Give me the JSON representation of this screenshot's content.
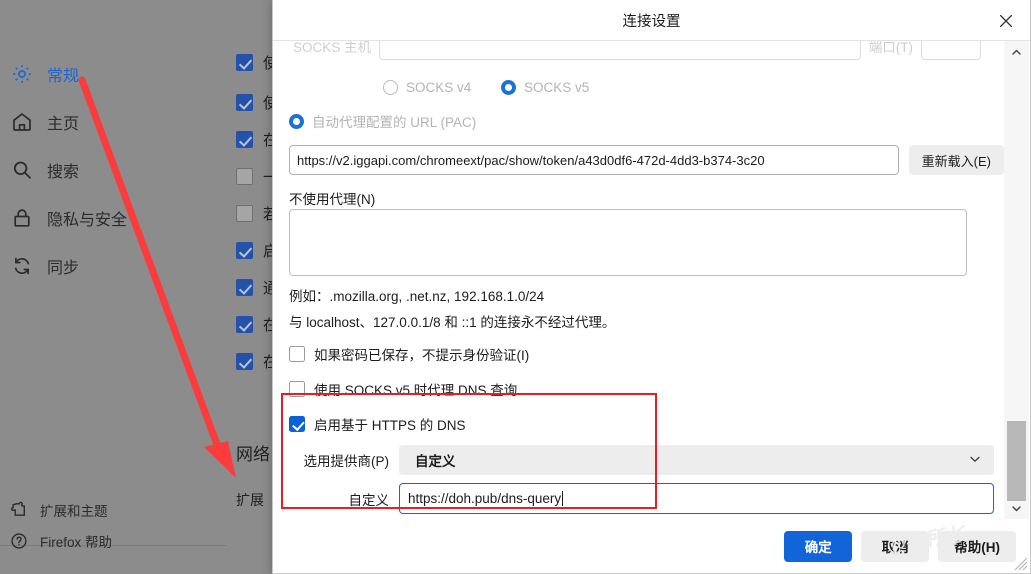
{
  "background": {
    "sidebar": {
      "items": [
        {
          "label": "常规",
          "icon": "gear-icon",
          "active": true
        },
        {
          "label": "主页",
          "icon": "home-icon",
          "active": false
        },
        {
          "label": "搜索",
          "icon": "search-icon",
          "active": false
        },
        {
          "label": "隐私与安全",
          "icon": "lock-icon",
          "active": false
        },
        {
          "label": "同步",
          "icon": "sync-icon",
          "active": false
        }
      ],
      "footer_items": [
        {
          "label": "扩展和主题",
          "icon": "puzzle-icon"
        },
        {
          "label": "Firefox 帮助",
          "icon": "help-circle-icon"
        }
      ]
    },
    "content": {
      "checkbox_rows": [
        {
          "text": "使",
          "checked": true
        },
        {
          "text": "使",
          "checked": true
        },
        {
          "text": "在",
          "checked": true
        },
        {
          "text": "一",
          "checked": false
        },
        {
          "text": "若",
          "checked": false
        },
        {
          "text": "启",
          "checked": true
        },
        {
          "text": "通",
          "checked": true
        },
        {
          "text": "在",
          "checked": true
        },
        {
          "text": "在",
          "checked": true
        }
      ],
      "section_title": "网络",
      "extension_label": "扩展"
    }
  },
  "dialog": {
    "title": "连接设置",
    "close_label": "✕",
    "socks": {
      "host_label": "SOCKS 主机",
      "host_value": "",
      "port_label": "端口(T)",
      "port_value": "",
      "version_options": [
        {
          "label": "SOCKS v4",
          "selected": false
        },
        {
          "label": "SOCKS v5",
          "selected": true
        }
      ]
    },
    "pac": {
      "radio_label": "自动代理配置的 URL (PAC)",
      "radio_selected": true,
      "url_value": "https://v2.iggapi.com/chromeext/pac/show/token/a43d0df6-472d-4dd3-b374-3c20",
      "reload_button": "重新载入(E)"
    },
    "no_proxy": {
      "label": "不使用代理(N)",
      "value": "",
      "example": "例如：.mozilla.org, .net.nz, 192.168.1.0/24",
      "note": "与 localhost、127.0.0.1/8 和 ::1 的连接永不经过代理。"
    },
    "checkboxes": [
      {
        "label": "如果密码已保存，不提示身份验证(I)",
        "checked": false
      },
      {
        "label": "使用 SOCKS v5 时代理 DNS 查询",
        "checked": false
      },
      {
        "label": "启用基于 HTTPS 的 DNS",
        "checked": true
      }
    ],
    "doh": {
      "provider_label": "选用提供商(P)",
      "provider_value": "自定义",
      "custom_label": "自定义",
      "custom_value": "https://doh.pub/dns-query",
      "highlight_color": "#ed1c24"
    },
    "footer_buttons": [
      {
        "label": "确定",
        "style": "primary"
      },
      {
        "label": "取消",
        "style": "secondary"
      },
      {
        "label": "帮助(H)",
        "style": "secondary"
      }
    ]
  },
  "annotation": {
    "arrow_color": "#fa3c3c",
    "watermark": "@李所长"
  },
  "colors": {
    "accent_blue": "#1265d8",
    "highlight_red": "#ed1c24",
    "dim_overlay": "#8c8c8c"
  }
}
